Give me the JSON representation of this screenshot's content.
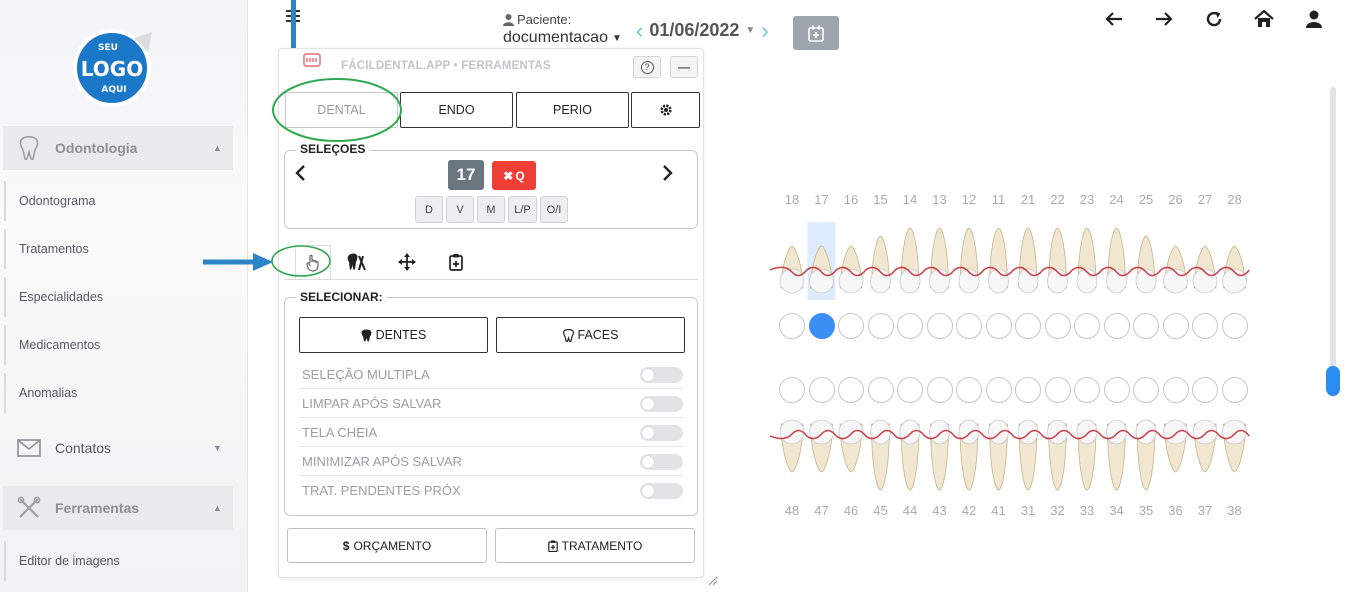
{
  "sidebar": {
    "logo_text": [
      "SEU",
      "LOGO",
      "AQUI"
    ],
    "groups": [
      {
        "label": "Odontologia",
        "icon": "tooth-icon"
      },
      {
        "label": "Contatos",
        "icon": "envelope-icon"
      },
      {
        "label": "Ferramentas",
        "icon": "tools-icon"
      }
    ],
    "items": [
      "Odontograma",
      "Tratamentos",
      "Especialidades",
      "Medicamentos",
      "Anomalias",
      "Editor de imagens"
    ]
  },
  "header": {
    "patient_label": "Paciente:",
    "patient_name": "documentacao",
    "date": "01/06/2022"
  },
  "panel": {
    "title": "FÁCILDENTAL.APP • FERRAMENTAS",
    "help": "?",
    "minimize": "—",
    "tabs": [
      "DENTAL",
      "ENDO",
      "PERIO"
    ],
    "selections_legend": "SELEÇOES",
    "tooth_number": "17",
    "clear_label": "Q",
    "faces": [
      "D",
      "V",
      "M",
      "L/P",
      "O/I"
    ],
    "select_legend": "SELECIONAR:",
    "select_teeth": "DENTES",
    "select_faces": "FACES",
    "options": [
      "SELEÇÃO MULTIPLA",
      "LIMPAR APÓS SALVAR",
      "TELA CHEIA",
      "MINIMIZAR APÓS SALVAR",
      "TRAT. PENDENTES PRÓX"
    ],
    "budget": "ORÇAMENTO",
    "treatment": "TRATAMENTO"
  },
  "chart": {
    "upper_numbers": [
      "18",
      "17",
      "16",
      "15",
      "14",
      "13",
      "12",
      "11",
      "21",
      "22",
      "23",
      "24",
      "25",
      "26",
      "27",
      "28"
    ],
    "lower_numbers": [
      "48",
      "47",
      "46",
      "45",
      "44",
      "43",
      "42",
      "41",
      "31",
      "32",
      "33",
      "34",
      "35",
      "36",
      "37",
      "38"
    ],
    "selected_tooth": "17",
    "colors": {
      "selected": "#3b8ef3",
      "gumline": "#c8414a",
      "accent": "#66c8dd",
      "annotation": "#2b84c6",
      "highlight": "#2fa84f"
    }
  }
}
